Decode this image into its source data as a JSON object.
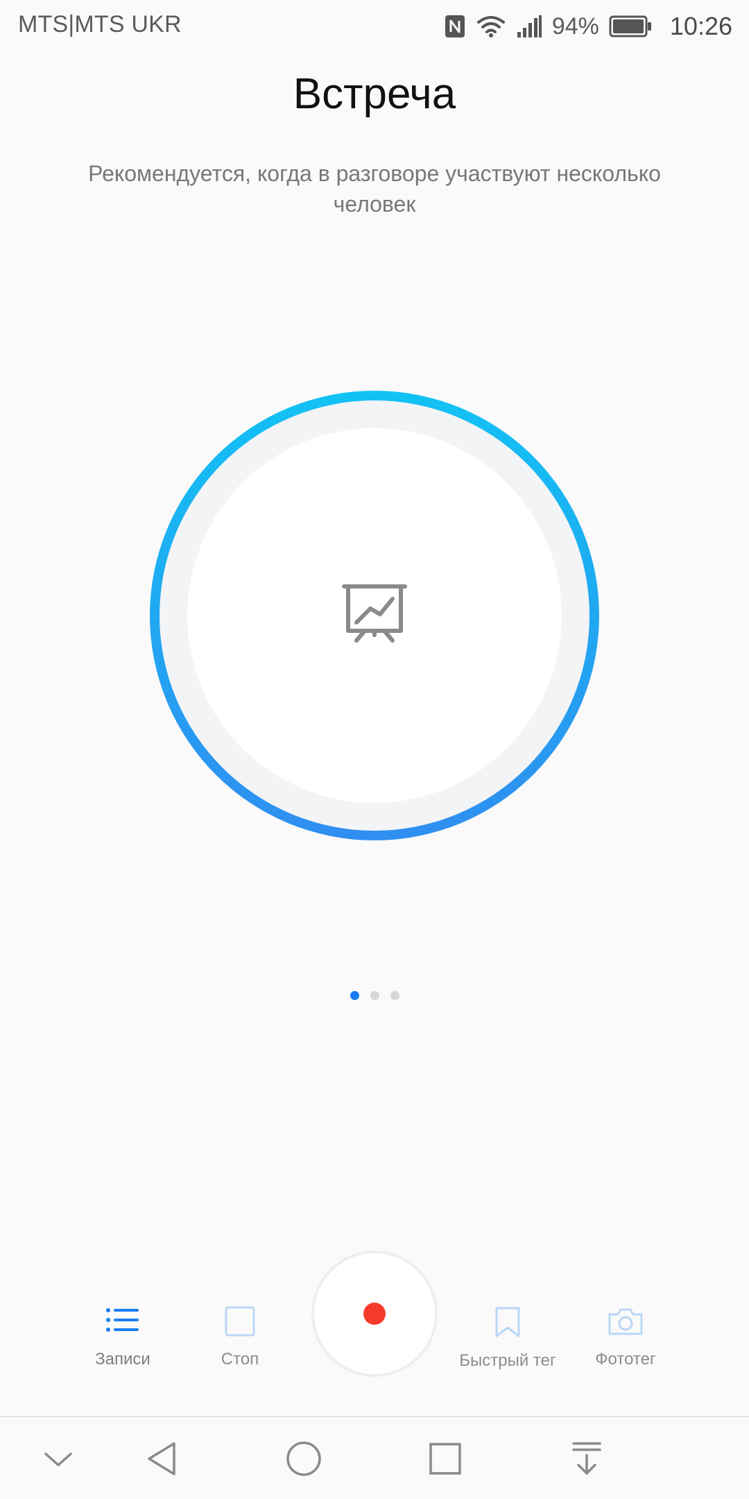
{
  "status_bar": {
    "carrier": "MTS|MTS UKR",
    "battery_percent": "94%",
    "time": "10:26",
    "icons": [
      "nfc-icon",
      "wifi-icon",
      "signal-icon",
      "battery-icon"
    ]
  },
  "mode": {
    "title": "Встреча",
    "description": "Рекомендуется, когда в разговоре участвуют несколько человек",
    "icon": "presentation-icon"
  },
  "pager": {
    "count": 3,
    "active_index": 0
  },
  "controls": {
    "records_label": "Записи",
    "stop_label": "Стоп",
    "quick_tag_label": "Быстрый тег",
    "photo_tag_label": "Фототег",
    "record_button": "record-icon"
  },
  "navigation": {
    "items": [
      "collapse-icon",
      "back-icon",
      "home-icon",
      "recents-icon",
      "notification-pull-icon"
    ]
  },
  "colors": {
    "accent_blue": "#1a7cf0",
    "ring_gradient_top": "#12c2f4",
    "ring_gradient_bottom": "#2f8ef0",
    "record_red": "#f53a2c",
    "control_icon_light_blue": "#b9d6f5"
  }
}
